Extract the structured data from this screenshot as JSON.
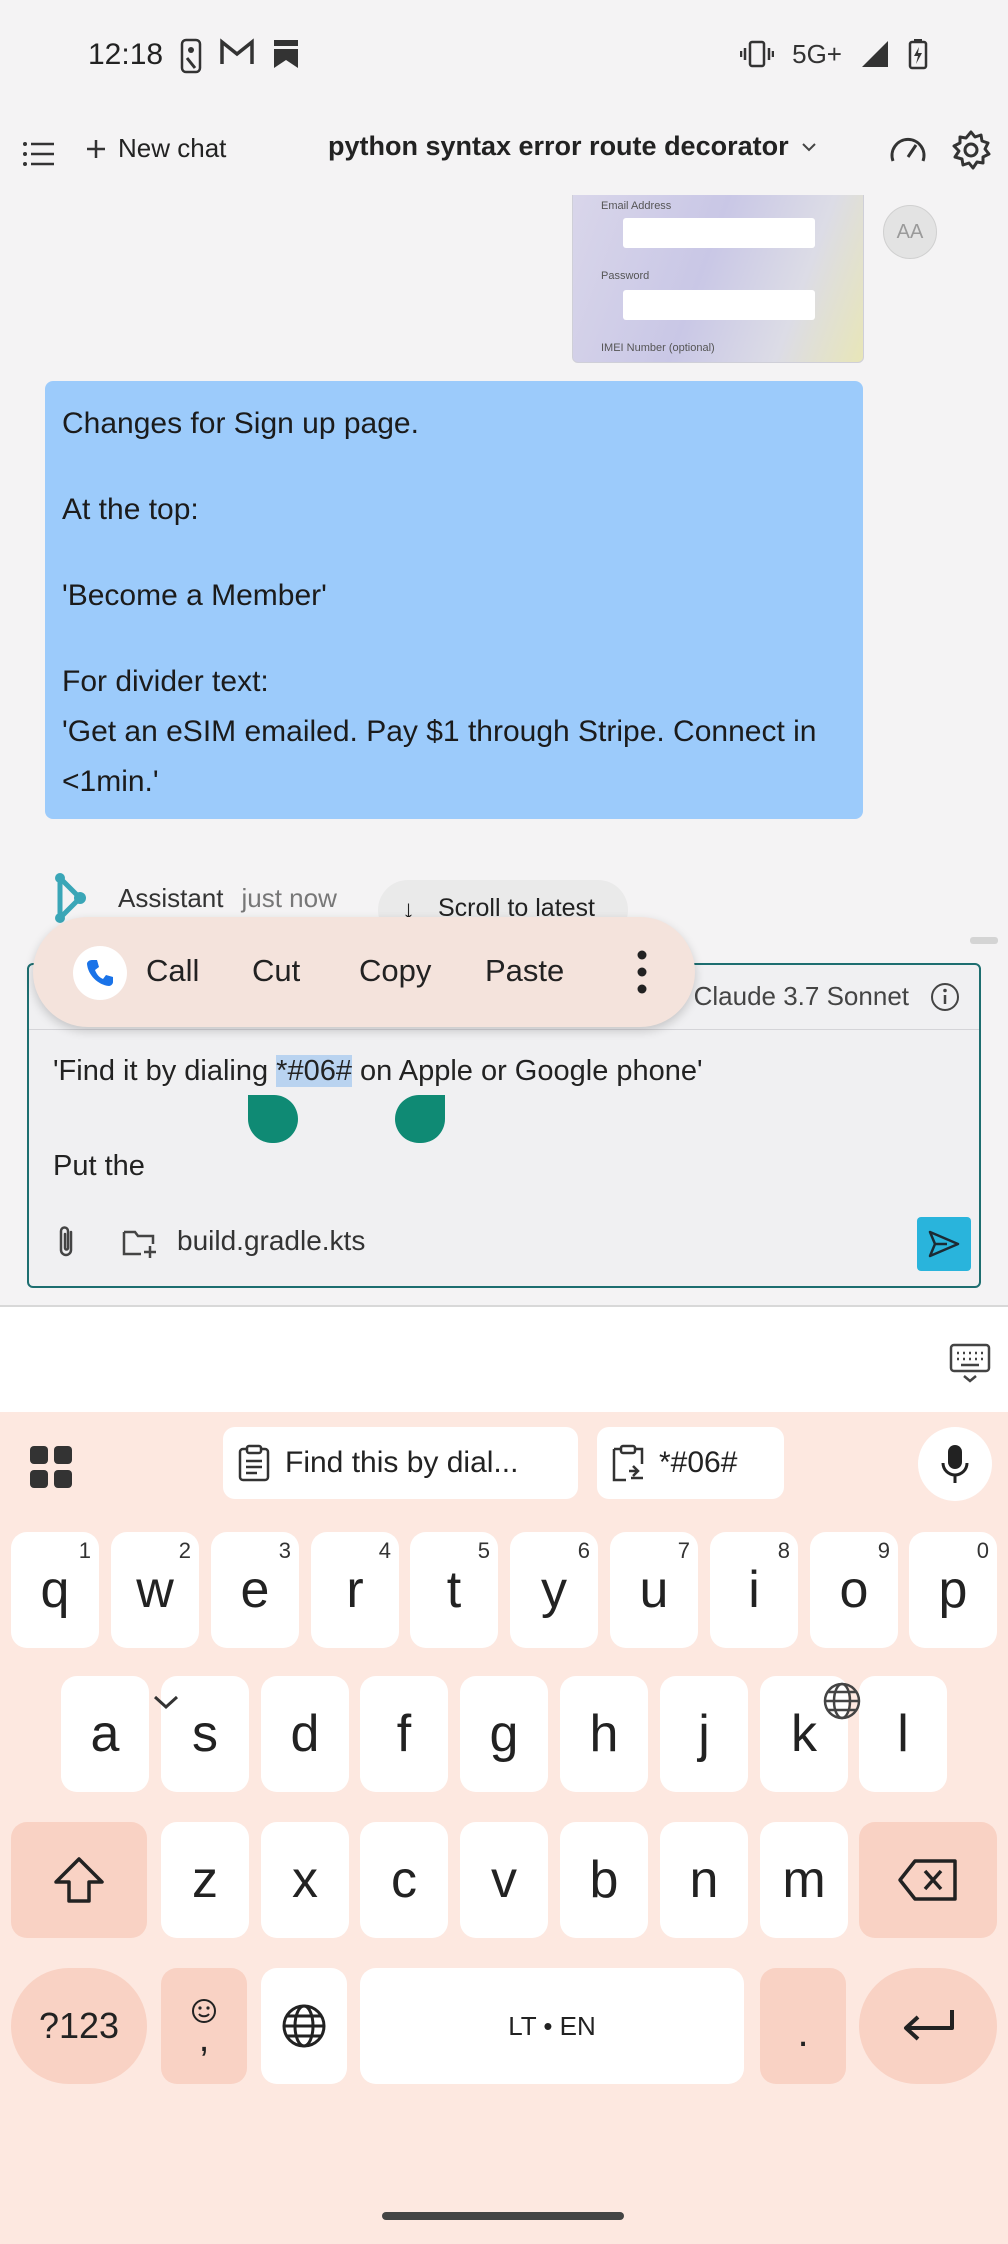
{
  "status_bar": {
    "time": "12:18",
    "network": "5G+"
  },
  "header": {
    "new_chat_label": "New chat",
    "title": "python syntax error route decorator"
  },
  "attachment_preview": {
    "email_label": "Email Address",
    "password_label": "Password",
    "imei_label": "IMEI Number (optional)"
  },
  "avatar": {
    "initials": "AA"
  },
  "user_message": {
    "line1": "Changes for Sign up page.",
    "line2": "At the top:",
    "line3": "'Become a Member'",
    "line4": "For divider text:",
    "line5": "'Get an eSIM emailed. Pay $1 through Stripe. Connect in <1min.'"
  },
  "assistant": {
    "name": "Assistant",
    "time": "just now"
  },
  "scroll_button": {
    "label": "Scroll to latest"
  },
  "context_menu": {
    "call": "Call",
    "cut": "Cut",
    "copy": "Copy",
    "paste": "Paste"
  },
  "composer": {
    "model": "Claude 3.7 Sonnet",
    "text_before": "'Find it by dialing ",
    "text_selected": "*#06#",
    "text_after": " on Apple or Google phone'",
    "text_line2": "Put the",
    "file_name": "build.gradle.kts"
  },
  "keyboard": {
    "clipboard_chip_1": "Find this by dial...",
    "clipboard_chip_2": "*#06#",
    "row1": [
      "q",
      "w",
      "e",
      "r",
      "t",
      "y",
      "u",
      "i",
      "o",
      "p"
    ],
    "row1_hints": [
      "1",
      "2",
      "3",
      "4",
      "5",
      "6",
      "7",
      "8",
      "9",
      "0"
    ],
    "row2": [
      "a",
      "s",
      "d",
      "f",
      "g",
      "h",
      "j",
      "k",
      "l"
    ],
    "row3": [
      "z",
      "x",
      "c",
      "v",
      "b",
      "n",
      "m"
    ],
    "symbols_label": "?123",
    "comma_label": ",",
    "space_label": "LT • EN",
    "period_label": "."
  },
  "colors": {
    "accent": "#29b4dc",
    "user_bubble": "#9ccbfb",
    "handle": "#0f8a74",
    "keyboard_bg": "#fde8e0"
  }
}
